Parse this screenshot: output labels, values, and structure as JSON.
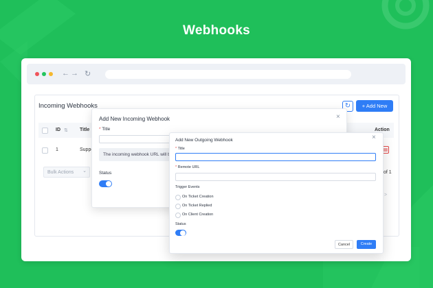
{
  "page_title": "Webhooks",
  "colors": {
    "background": "#1fbf5a",
    "accent": "#2f7df6",
    "danger": "#e54848"
  },
  "browser": {
    "nav_back": "←",
    "nav_forward": "→",
    "reload": "↻"
  },
  "card": {
    "title": "Incoming Webhooks",
    "refresh_icon": "↻",
    "add_new_label": "+ Add New",
    "columns": {
      "id": "ID",
      "sort": "⇅",
      "title": "Title",
      "action": "Action"
    },
    "rows": [
      {
        "id": "1",
        "title": "Suppo"
      }
    ],
    "bulk_actions": "Bulk Actions",
    "bulk_chevron": "⌄",
    "pagination": "of 1",
    "next_icon": ">"
  },
  "incoming_modal": {
    "title": "Add New Incoming Webhook",
    "close": "×",
    "title_label": "Title",
    "required_mark": "*",
    "url_info": "The incoming webhook URL will b",
    "status_label": "Status",
    "status_on": true
  },
  "outgoing_modal": {
    "title": "Add New Outgoing Webhook",
    "close": "×",
    "title_label": "Title",
    "remote_url_label": "Remote URL",
    "required_mark": "*",
    "trigger_label": "Trigger Events",
    "triggers": [
      "On Ticket Creation",
      "On Ticket Replied",
      "On Client Creation"
    ],
    "status_label": "Status",
    "status_on": true,
    "cancel_label": "Cancel",
    "create_label": "Create"
  }
}
